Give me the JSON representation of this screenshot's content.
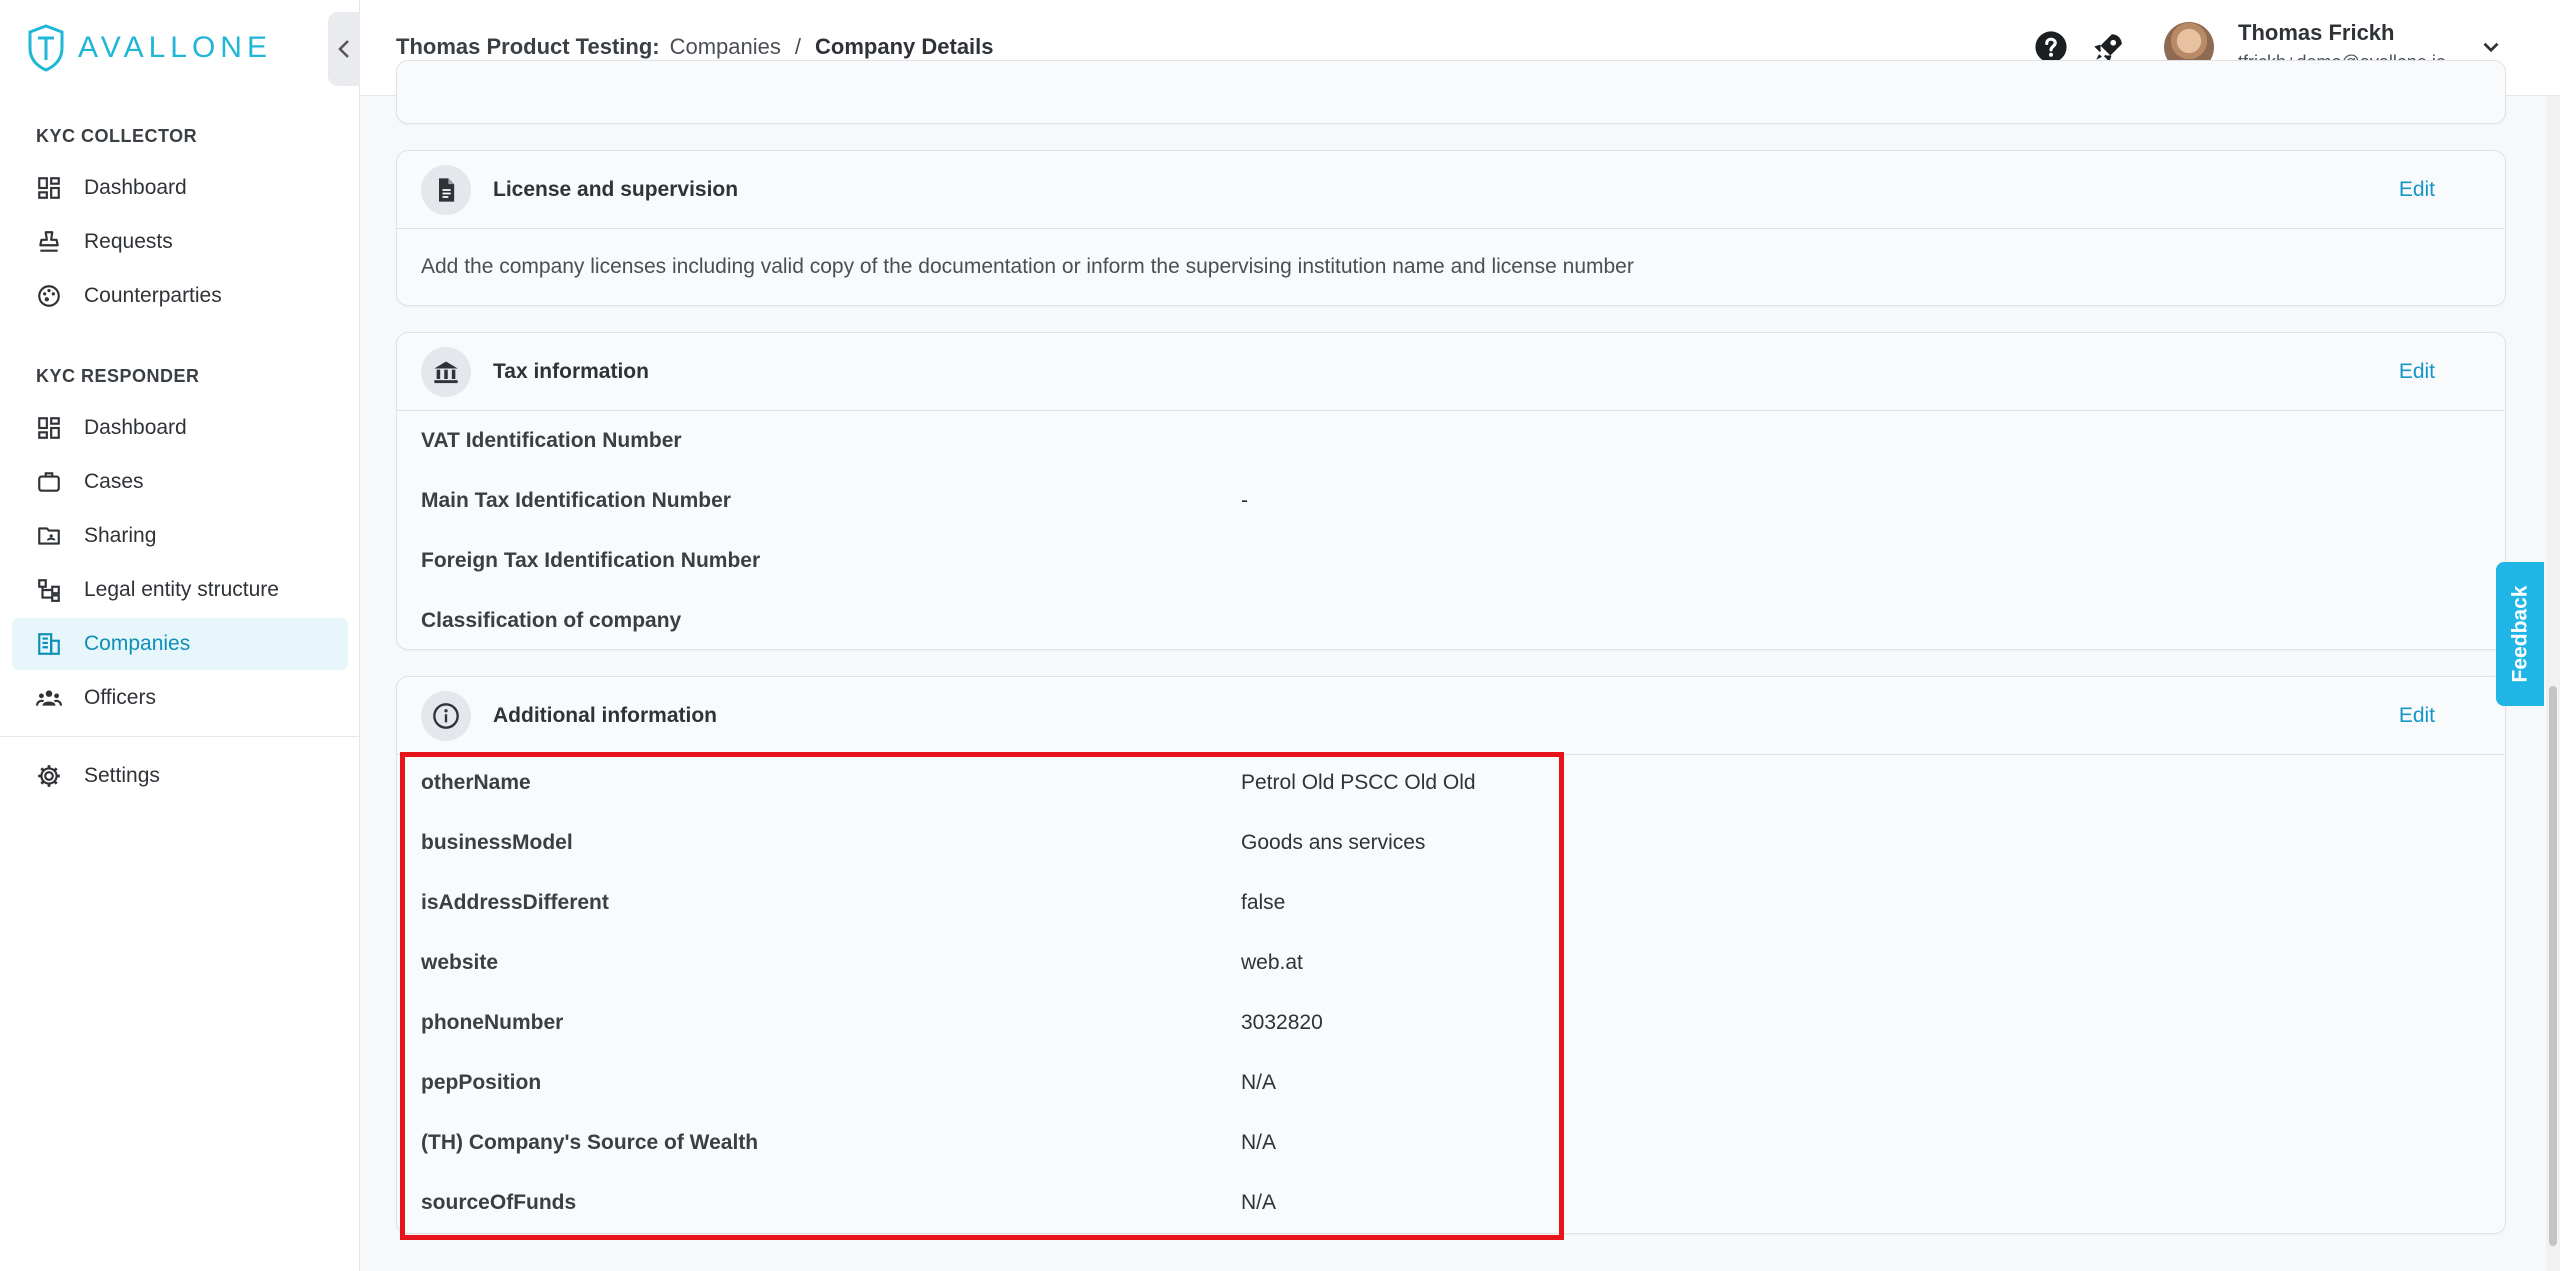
{
  "brand": {
    "name": "AVALLONE",
    "accent": "#1fb6d8"
  },
  "sidebar": {
    "collector_title": "KYC COLLECTOR",
    "collector_items": [
      {
        "label": "Dashboard",
        "icon": "dashboard-icon"
      },
      {
        "label": "Requests",
        "icon": "stamp-icon"
      },
      {
        "label": "Counterparties",
        "icon": "palette-icon"
      }
    ],
    "responder_title": "KYC RESPONDER",
    "responder_items": [
      {
        "label": "Dashboard",
        "icon": "dashboard-icon"
      },
      {
        "label": "Cases",
        "icon": "briefcase-icon"
      },
      {
        "label": "Sharing",
        "icon": "shared-folder-icon"
      },
      {
        "label": "Legal entity structure",
        "icon": "hierarchy-icon"
      },
      {
        "label": "Companies",
        "icon": "building-icon",
        "active": true
      },
      {
        "label": "Officers",
        "icon": "people-icon"
      }
    ],
    "settings_label": "Settings"
  },
  "header": {
    "app_name": "Thomas Product Testing:",
    "crumb_link": "Companies",
    "separator": "/",
    "crumb_current": "Company Details",
    "user_name": "Thomas Frickh",
    "user_email": "tfrickh+demo@avallone.io"
  },
  "license_card": {
    "title": "License and supervision",
    "edit_label": "Edit",
    "description": "Add the company licenses including valid copy of the documentation or inform the supervising institution name and license number"
  },
  "tax_card": {
    "title": "Tax information",
    "edit_label": "Edit",
    "rows": [
      {
        "label": "VAT Identification Number",
        "value": ""
      },
      {
        "label": "Main Tax Identification Number",
        "value": "-"
      },
      {
        "label": "Foreign Tax Identification Number",
        "value": ""
      },
      {
        "label": "Classification of company",
        "value": ""
      }
    ]
  },
  "additional_card": {
    "title": "Additional information",
    "edit_label": "Edit",
    "rows": [
      {
        "label": "otherName",
        "value": "Petrol Old PSCC Old Old"
      },
      {
        "label": "businessModel",
        "value": "Goods ans services"
      },
      {
        "label": "isAddressDifferent",
        "value": "false"
      },
      {
        "label": "website",
        "value": "web.at"
      },
      {
        "label": "phoneNumber",
        "value": "3032820"
      },
      {
        "label": "pepPosition",
        "value": "N/A"
      },
      {
        "label": "(TH) Company's Source of Wealth",
        "value": "N/A"
      },
      {
        "label": "sourceOfFunds",
        "value": "N/A"
      }
    ]
  },
  "feedback_label": "Feedback",
  "colors": {
    "link": "#1597c6",
    "active_bg": "#e6f6fb",
    "highlight": "#e8141c",
    "feedback": "#1fb6e6"
  }
}
